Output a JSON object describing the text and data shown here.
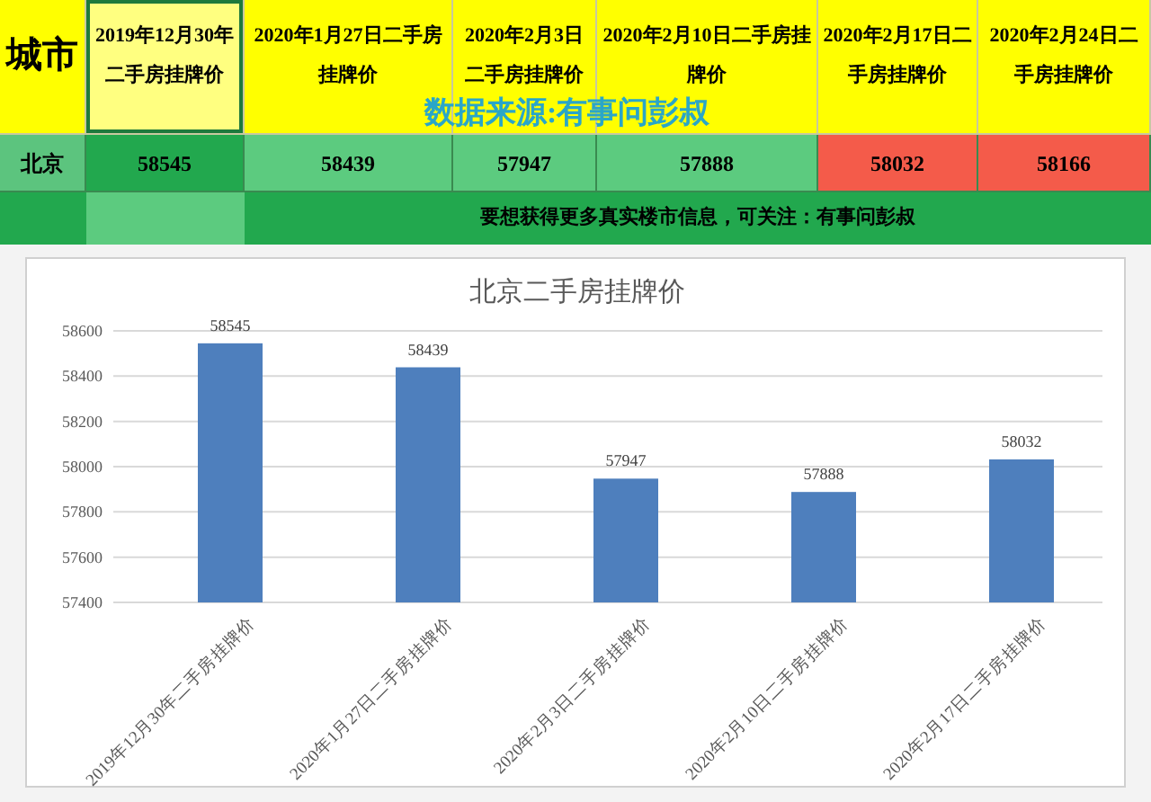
{
  "table": {
    "header": [
      {
        "label": "城市",
        "selected": false
      },
      {
        "label": "2019年12月30年二手房挂牌价",
        "selected": true
      },
      {
        "label": "2020年1月27日二手房挂牌价",
        "selected": false
      },
      {
        "label": "2020年2月3日二手房挂牌价",
        "selected": false
      },
      {
        "label": "2020年2月10日二手房挂牌价",
        "selected": false
      },
      {
        "label": "2020年2月17日二手房挂牌价",
        "selected": false
      },
      {
        "label": "2020年2月24日二手房挂牌价",
        "selected": false
      }
    ],
    "rows": [
      {
        "city": "北京",
        "cells": [
          {
            "value": "58545",
            "color": "#22a84e"
          },
          {
            "value": "58439",
            "color": "#5ccb7f"
          },
          {
            "value": "57947",
            "color": "#5ccb7f"
          },
          {
            "value": "57888",
            "color": "#5ccb7f"
          },
          {
            "value": "58032",
            "color": "#f45b4a"
          },
          {
            "value": "58166",
            "color": "#f45b4a"
          }
        ]
      }
    ],
    "note": "要想获得更多真实楼市信息，可关注：有事问彭叔"
  },
  "source_label": "数据来源:有事问彭叔",
  "chart": {
    "chart_data": {
      "type": "bar",
      "title": "北京二手房挂牌价",
      "categories": [
        "2019年12月30年二手房挂牌价",
        "2020年1月27日二手房挂牌价",
        "2020年2月3日二手房挂牌价",
        "2020年2月10日二手房挂牌价",
        "2020年2月17日二手房挂牌价"
      ],
      "series": [
        {
          "color": "#4e7fbd",
          "values": [
            58545,
            58439,
            57947,
            57888,
            58032
          ]
        }
      ],
      "ylim": [
        57400,
        58600
      ],
      "yticks": [
        57400,
        57600,
        57800,
        58000,
        58200,
        58400,
        58600
      ],
      "grid": true,
      "value_labels": [
        "58545",
        "58439",
        "57947",
        "57888",
        "58032"
      ]
    }
  }
}
